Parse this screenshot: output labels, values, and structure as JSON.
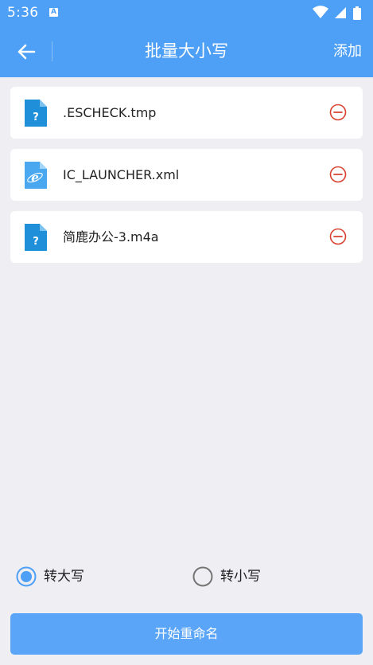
{
  "status_bar": {
    "time": "5:36",
    "notification_letter": "A",
    "icons": [
      "wifi-icon",
      "signal-icon",
      "battery-icon"
    ]
  },
  "toolbar": {
    "back_icon": "arrow-left-icon",
    "title": "批量大小写",
    "add_label": "添加"
  },
  "files": [
    {
      "name": ".ESCHECK.tmp",
      "icon": "unknown-file-icon",
      "action_icon": "remove-circle-icon"
    },
    {
      "name": "IC_LAUNCHER.xml",
      "icon": "web-file-icon",
      "action_icon": "remove-circle-icon"
    },
    {
      "name": "简鹿办公-3.m4a",
      "icon": "unknown-file-icon",
      "action_icon": "remove-circle-icon"
    }
  ],
  "case_options": {
    "upper_label": "转大写",
    "lower_label": "转小写",
    "selected": "upper"
  },
  "start_button_label": "开始重命名",
  "colors": {
    "primary": "#4e9ff6",
    "button": "#5aa5f7",
    "background": "#efeff3",
    "remove": "#d8412f",
    "file_icon": "#1e8fd8"
  }
}
